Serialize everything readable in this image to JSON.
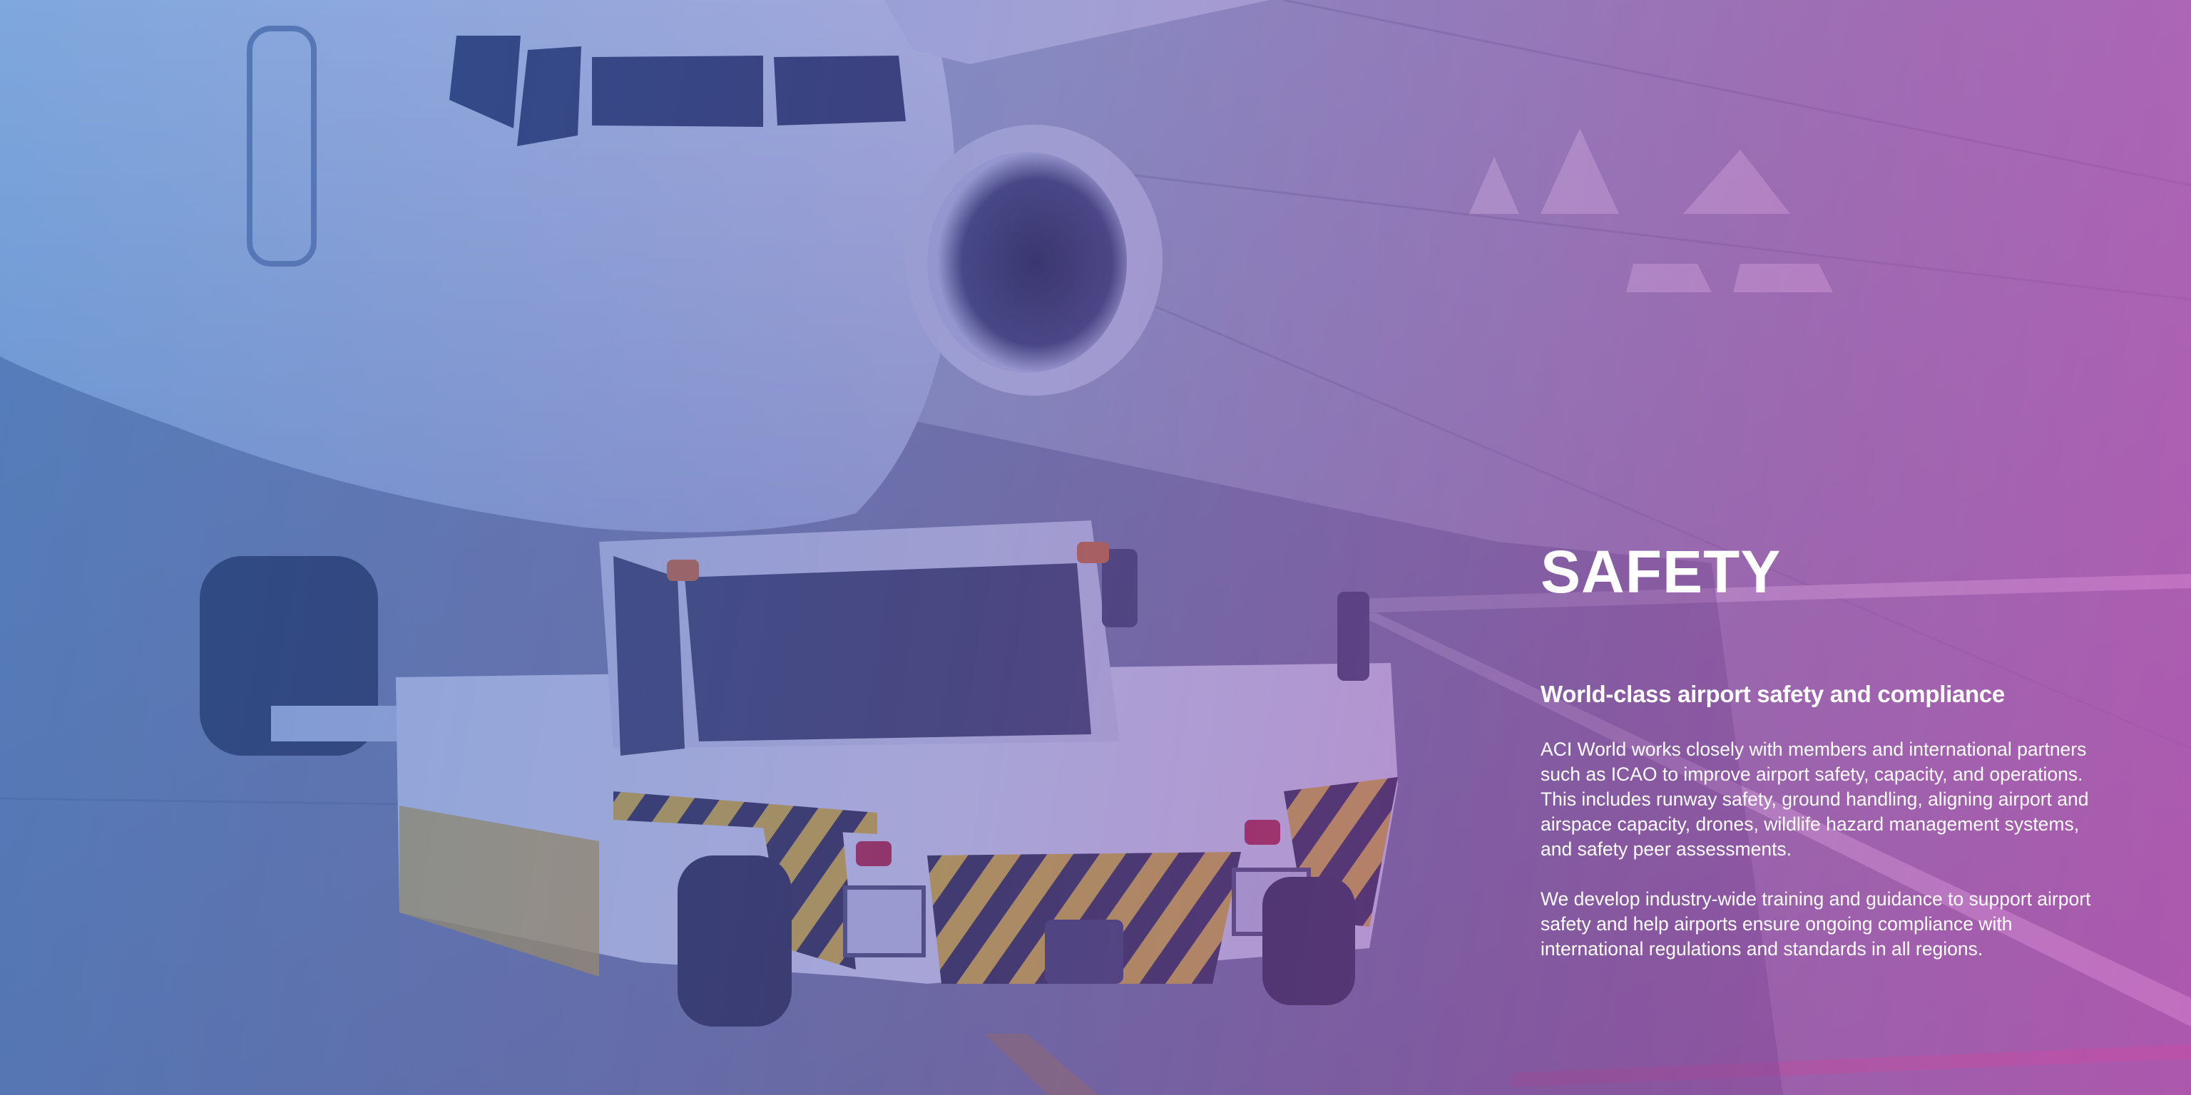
{
  "section": {
    "title": "SAFETY",
    "subtitle": "World-class airport safety and compliance",
    "paragraphs": [
      "ACI World works closely with members and international partners such as ICAO to improve airport safety, capacity, and operations. This includes runway safety, ground handling, aligning airport and airspace capacity, drones, wildlife hazard management systems, and safety peer assessments.",
      "We develop industry-wide training and guidance to support airport safety and help airports ensure ongoing compliance with international regulations and standards in all regions."
    ]
  },
  "colors": {
    "overlay_left": "#3a6ec8",
    "overlay_right": "#b43cb4",
    "text": "#ffffff",
    "tug_stripe_yellow": "#e8c020",
    "tug_stripe_dark": "#2a2a3a"
  }
}
